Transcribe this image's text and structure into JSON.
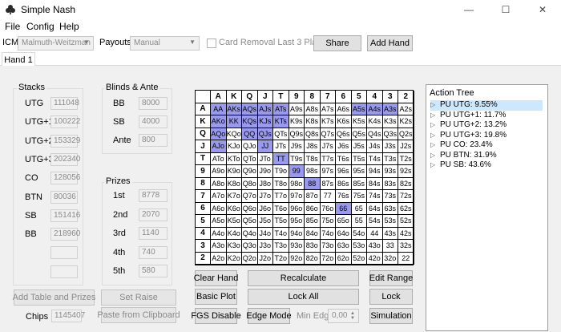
{
  "window": {
    "title": "Simple Nash",
    "minimize": "—",
    "maximize": "☐",
    "close": "✕"
  },
  "menu": [
    "File",
    "Config",
    "Help"
  ],
  "toolbar": {
    "icm_label": "ICM",
    "icm_value": "Malmuth-Weitzman",
    "payouts_label": "Payouts",
    "payouts_value": "Manual",
    "card_removal_label": "Card Removal Last 3 Players",
    "share_label": "Share",
    "add_hand_label": "Add Hand"
  },
  "tabs": [
    "Hand 1"
  ],
  "stacks": {
    "title": "Stacks",
    "rows": [
      {
        "pos": "UTG",
        "value": "111048"
      },
      {
        "pos": "UTG+1",
        "value": "100222"
      },
      {
        "pos": "UTG+2",
        "value": "153329"
      },
      {
        "pos": "UTG+3",
        "value": "202340"
      },
      {
        "pos": "CO",
        "value": "128056"
      },
      {
        "pos": "BTN",
        "value": "80036"
      },
      {
        "pos": "SB",
        "value": "151416"
      },
      {
        "pos": "BB",
        "value": "218960"
      },
      {
        "pos": "",
        "value": ""
      },
      {
        "pos": "",
        "value": ""
      }
    ]
  },
  "blinds": {
    "title": "Blinds & Ante",
    "rows": [
      {
        "label": "BB",
        "value": "8000"
      },
      {
        "label": "SB",
        "value": "4000"
      },
      {
        "label": "Ante",
        "value": "800"
      }
    ]
  },
  "prizes": {
    "title": "Prizes",
    "rows": [
      {
        "label": "1st",
        "value": "8778"
      },
      {
        "label": "2nd",
        "value": "2070"
      },
      {
        "label": "3rd",
        "value": "1140"
      },
      {
        "label": "4th",
        "value": "740"
      },
      {
        "label": "5th",
        "value": "580"
      }
    ]
  },
  "bottom_left": {
    "add_table_label": "Add Table and Prizes",
    "set_raise_label": "Set Raise",
    "chips_label": "Chips",
    "chips_value": "1145407",
    "paste_label": "Paste from Clipboard"
  },
  "matrix": {
    "ranks": [
      "A",
      "K",
      "Q",
      "J",
      "T",
      "9",
      "8",
      "7",
      "6",
      "5",
      "4",
      "3",
      "2"
    ],
    "rows": [
      [
        "AA",
        "AKs",
        "AQs",
        "AJs",
        "ATs",
        "A9s",
        "A8s",
        "A7s",
        "A6s",
        "A5s",
        "A4s",
        "A3s",
        "A2s"
      ],
      [
        "AKo",
        "KK",
        "KQs",
        "KJs",
        "KTs",
        "K9s",
        "K8s",
        "K7s",
        "K6s",
        "K5s",
        "K4s",
        "K3s",
        "K2s"
      ],
      [
        "AQo",
        "KQo",
        "QQ",
        "QJs",
        "QTs",
        "Q9s",
        "Q8s",
        "Q7s",
        "Q6s",
        "Q5s",
        "Q4s",
        "Q3s",
        "Q2s"
      ],
      [
        "AJo",
        "KJo",
        "QJo",
        "JJ",
        "JTs",
        "J9s",
        "J8s",
        "J7s",
        "J6s",
        "J5s",
        "J4s",
        "J3s",
        "J2s"
      ],
      [
        "ATo",
        "KTo",
        "QTo",
        "JTo",
        "TT",
        "T9s",
        "T8s",
        "T7s",
        "T6s",
        "T5s",
        "T4s",
        "T3s",
        "T2s"
      ],
      [
        "A9o",
        "K9o",
        "Q9o",
        "J9o",
        "T9o",
        "99",
        "98s",
        "97s",
        "96s",
        "95s",
        "94s",
        "93s",
        "92s"
      ],
      [
        "A8o",
        "K8o",
        "Q8o",
        "J8o",
        "T8o",
        "98o",
        "88",
        "87s",
        "86s",
        "85s",
        "84s",
        "83s",
        "82s"
      ],
      [
        "A7o",
        "K7o",
        "Q7o",
        "J7o",
        "T7o",
        "97o",
        "87o",
        "77",
        "76s",
        "75s",
        "74s",
        "73s",
        "72s"
      ],
      [
        "A6o",
        "K6o",
        "Q6o",
        "J6o",
        "T6o",
        "96o",
        "86o",
        "76o",
        "66",
        "65",
        "64s",
        "63s",
        "62s"
      ],
      [
        "A5o",
        "K5o",
        "Q5o",
        "J5o",
        "T5o",
        "95o",
        "85o",
        "75o",
        "65o",
        "55",
        "54s",
        "53s",
        "52s"
      ],
      [
        "A4o",
        "K4o",
        "Q4o",
        "J4o",
        "T4o",
        "94o",
        "84o",
        "74o",
        "64o",
        "54o",
        "44",
        "43s",
        "42s"
      ],
      [
        "A3o",
        "K3o",
        "Q3o",
        "J3o",
        "T3o",
        "93o",
        "83o",
        "73o",
        "63o",
        "53o",
        "43o",
        "33",
        "32s"
      ],
      [
        "A2o",
        "K2o",
        "Q2o",
        "J2o",
        "T2o",
        "92o",
        "82o",
        "72o",
        "62o",
        "52o",
        "42o",
        "32o",
        "22"
      ]
    ],
    "selected": [
      "AA",
      "AKs",
      "AQs",
      "AJs",
      "ATs",
      "A5s",
      "A4s",
      "A3s",
      "AKo",
      "KK",
      "KQs",
      "KJs",
      "KTs",
      "AQo",
      "QQ",
      "QJs",
      "AJo",
      "JJ",
      "TT",
      "99",
      "88",
      "66"
    ],
    "highlight_color": "#9999ee"
  },
  "buttons": {
    "clear_hand": "Clear Hand",
    "recalculate": "Recalculate",
    "edit_range": "Edit Range",
    "basic_plot": "Basic Plot",
    "lock_all": "Lock All",
    "lock": "Lock",
    "fgs_disable": "FGS Disable",
    "edge_mode": "Edge Mode",
    "min_edge_label": "Min Edge",
    "min_edge_value": "0,00",
    "simulation": "Simulation"
  },
  "tree": {
    "title": "Action Tree",
    "items": [
      {
        "label": "PU UTG: 9.55%",
        "selected": true
      },
      {
        "label": "PU UTG+1: 11.7%",
        "selected": false
      },
      {
        "label": "PU UTG+2: 13.2%",
        "selected": false
      },
      {
        "label": "PU UTG+3: 19.8%",
        "selected": false
      },
      {
        "label": "PU CO: 23.4%",
        "selected": false
      },
      {
        "label": "PU BTN: 31.9%",
        "selected": false
      },
      {
        "label": "PU SB: 43.6%",
        "selected": false
      }
    ]
  }
}
